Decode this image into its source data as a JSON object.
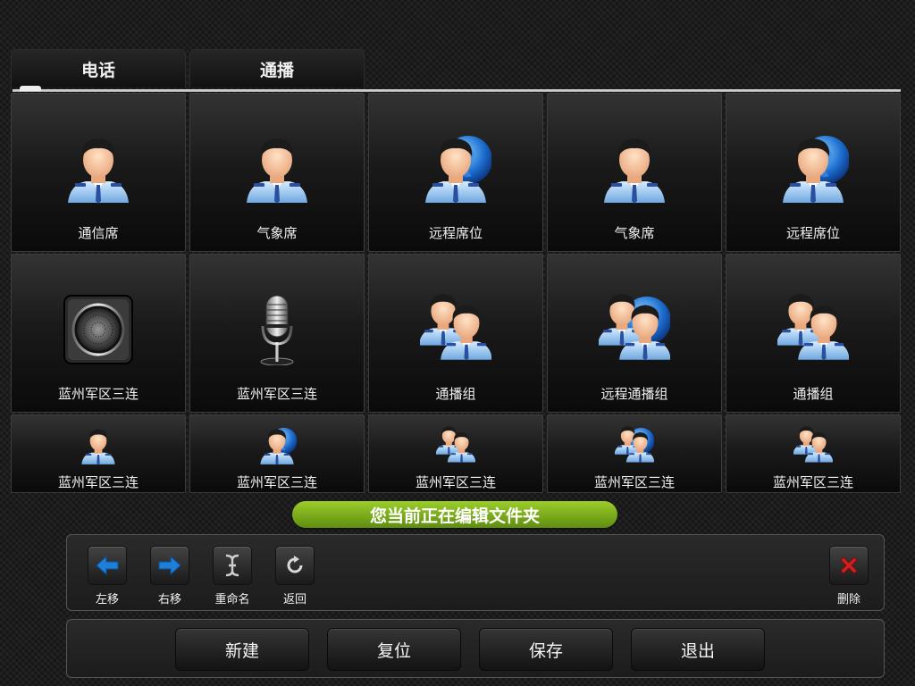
{
  "tabs": [
    {
      "label": "电话"
    },
    {
      "label": "通播"
    }
  ],
  "grid": {
    "rows": [
      [
        {
          "label": "通信席",
          "icon": "person-icon"
        },
        {
          "label": "气象席",
          "icon": "person-icon"
        },
        {
          "label": "远程席位",
          "icon": "remote-person-icon"
        },
        {
          "label": "气象席",
          "icon": "person-icon"
        },
        {
          "label": "远程席位",
          "icon": "remote-person-icon"
        }
      ],
      [
        {
          "label": "蓝州军区三连",
          "icon": "speaker-icon"
        },
        {
          "label": "蓝州军区三连",
          "icon": "microphone-icon"
        },
        {
          "label": "通播组",
          "icon": "group-icon"
        },
        {
          "label": "远程通播组",
          "icon": "remote-group-icon"
        },
        {
          "label": "通播组",
          "icon": "group-icon"
        }
      ],
      [
        {
          "label": "蓝州军区三连",
          "icon": "person-icon"
        },
        {
          "label": "蓝州军区三连",
          "icon": "remote-person-icon"
        },
        {
          "label": "蓝州军区三连",
          "icon": "group-icon"
        },
        {
          "label": "蓝州军区三连",
          "icon": "remote-group-icon"
        },
        {
          "label": "蓝州军区三连",
          "icon": "group-icon"
        }
      ]
    ]
  },
  "banner": {
    "text": "您当前正在编辑文件夹"
  },
  "toolbar": {
    "move_left": "左移",
    "move_right": "右移",
    "rename": "重命名",
    "back": "返回",
    "delete": "删除"
  },
  "actions": {
    "new": "新建",
    "reset": "复位",
    "save": "保存",
    "exit": "退出"
  },
  "colors": {
    "banner": "#7fb31e",
    "arrow": "#1e7fd8",
    "delete": "#d22020"
  }
}
